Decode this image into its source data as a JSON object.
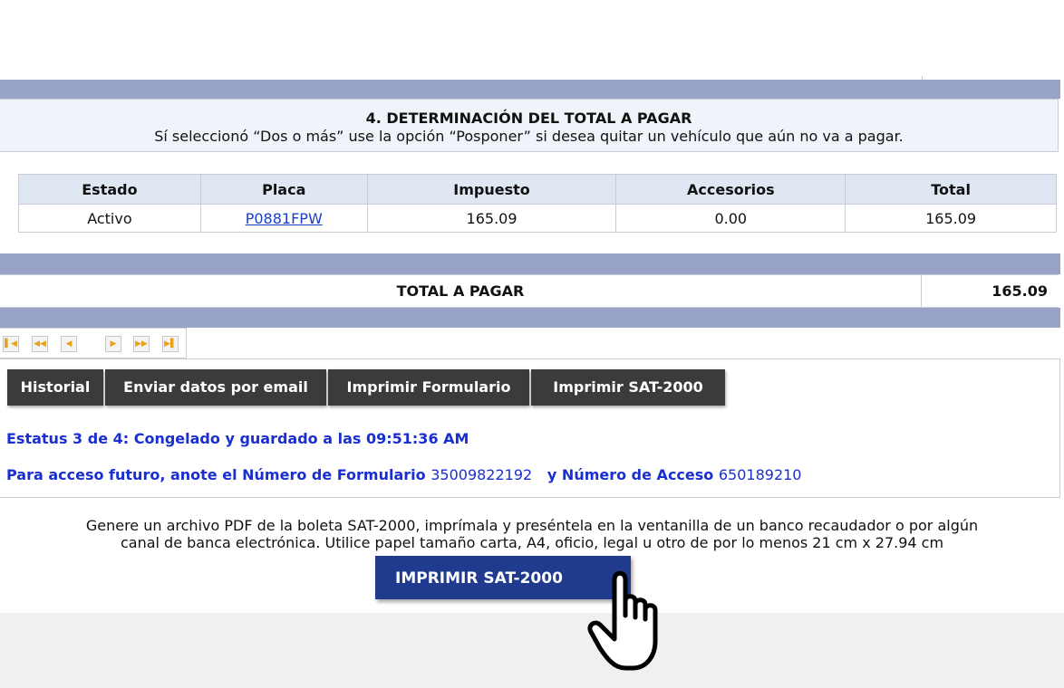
{
  "section": {
    "title": "4. DETERMINACIÓN DEL TOTAL A PAGAR",
    "subtitle": "Sí seleccionó “Dos o más” use la opción “Posponer” si desea quitar un vehículo que aún no va a pagar."
  },
  "table": {
    "headers": [
      "Estado",
      "Placa",
      "Impuesto",
      "Accesorios",
      "Total"
    ],
    "rows": [
      {
        "estado": "Activo",
        "placa": "P0881FPW",
        "impuesto": "165.09",
        "accesorios": "0.00",
        "total": "165.09"
      }
    ]
  },
  "total": {
    "label": "TOTAL A PAGAR",
    "value": "165.09"
  },
  "pager": {
    "icons": [
      "first-page-icon",
      "prev-fast-icon",
      "prev-icon",
      "next-icon",
      "next-fast-icon",
      "last-page-icon"
    ]
  },
  "actions": {
    "historial": "Historial",
    "email": "Enviar datos por email",
    "imprimir_formulario": "Imprimir Formulario",
    "imprimir_sat": "Imprimir SAT-2000"
  },
  "status": {
    "line": "Estatus 3 de 4: Congelado y guardado a las 09:51:36 AM",
    "access_prefix": "Para acceso futuro, anote el Número de Formulario",
    "form_number": "35009822192",
    "access_mid": "y Número de Acceso",
    "access_number": "650189210"
  },
  "instructions": {
    "line1": "Genere un archivo PDF de la boleta SAT-2000, imprímala y preséntela en la ventanilla de un banco recaudador o por algún",
    "line2": "canal de banca electrónica. Utilice papel tamaño carta, A4, oficio, legal u otro de por lo menos 21 cm x 27.94 cm"
  },
  "print_button": {
    "label": "IMPRIMIR SAT-2000"
  },
  "colors": {
    "bar": "#98a3c7",
    "header_bg": "#eef4fa",
    "button_dark": "#3b3b3b",
    "button_primary": "#203a8d",
    "status_text": "#1a2fd0",
    "link": "#1a3fc8"
  }
}
